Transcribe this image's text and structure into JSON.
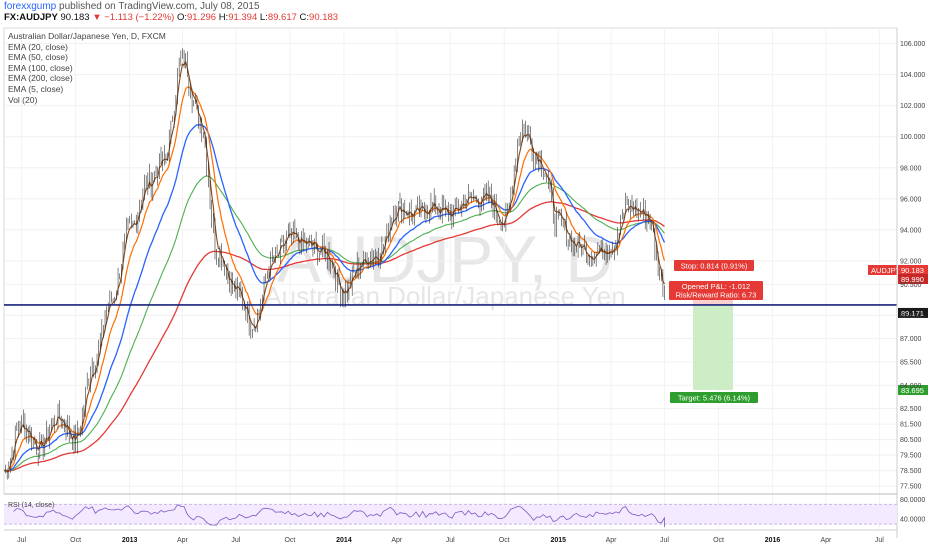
{
  "header": {
    "author": "forexxgump",
    "published_text": "published on TradingView.com, July 08, 2015",
    "symbol": "FX:AUDJPY",
    "last": "90.183",
    "change_arrow": "▼",
    "change": "−1.113 (−1.22%)",
    "open_label": "O:",
    "open": "91.296",
    "high_label": "H:",
    "high": "91.394",
    "low_label": "L:",
    "low": "89.617",
    "close_label": "C:",
    "close": "90.183"
  },
  "legend": {
    "title": "Australian Dollar/Japanese Yen, D, FXCM",
    "items": [
      "EMA (20, close)",
      "EMA (50, close)",
      "EMA (100, close)",
      "EMA (200, close)",
      "EMA (5, close)",
      "Vol (20)"
    ]
  },
  "watermark": {
    "symbol": "AUDJPY, D",
    "name": "Australian Dollar/Japanese Yen"
  },
  "annotations": {
    "stop": "Stop: 0.814 (0.91%)",
    "pnl": "Opened P&L: -1.012",
    "rr": "Risk/Reward Ratio: 6.73",
    "target": "Target: 5.476 (6.14%)"
  },
  "price_tags": {
    "symbol_tag": "AUDJPY",
    "last": "90.183",
    "hidden": "89.990",
    "entry": "89.171",
    "target": "83.695"
  },
  "rsi": {
    "label": "RSI (14, close)",
    "ticks": [
      "80.0000",
      "40.0000"
    ],
    "upper_band": 70,
    "lower_band": 30
  },
  "colors": {
    "ema20": "#ff6d00",
    "ema50": "#2962ff",
    "ema100": "#4caf50",
    "ema200": "#e53935",
    "ema5": "#8b4513",
    "price_line": "#1a237e",
    "rsi": "#7e57c2",
    "stop": "#e53935",
    "target": "#2e9e2e"
  },
  "chart_data": {
    "type": "candlestick",
    "y_ticks": [
      106,
      104,
      102,
      100,
      98,
      96,
      94,
      92,
      90.5,
      88.5,
      87,
      85.5,
      84,
      82.5,
      81.5,
      80.5,
      79.5,
      78.5,
      77.5
    ],
    "y_tick_labels": [
      "106.000",
      "104.000",
      "102.000",
      "100.000",
      "98.000",
      "96.000",
      "94.000",
      "92.000",
      "90.500",
      "88.500",
      "87.000",
      "85.500",
      "84.000",
      "82.500",
      "81.500",
      "80.500",
      "79.500",
      "78.500",
      "77.500"
    ],
    "x_ticks": [
      "Jul",
      "Oct",
      "2013",
      "Apr",
      "Jul",
      "Oct",
      "2014",
      "Apr",
      "Jul",
      "Oct",
      "2015",
      "Apr",
      "Jul",
      "Oct",
      "2016",
      "Apr",
      "Jul"
    ],
    "close_path": [
      {
        "date": "2012-06-01",
        "price": 78.5
      },
      {
        "date": "2012-07-01",
        "price": 81.5
      },
      {
        "date": "2012-08-01",
        "price": 80.0
      },
      {
        "date": "2012-09-01",
        "price": 82.0
      },
      {
        "date": "2012-10-01",
        "price": 80.5
      },
      {
        "date": "2012-11-01",
        "price": 85.5
      },
      {
        "date": "2012-12-01",
        "price": 89.5
      },
      {
        "date": "2013-01-01",
        "price": 94.0
      },
      {
        "date": "2013-02-01",
        "price": 97.0
      },
      {
        "date": "2013-03-01",
        "price": 98.5
      },
      {
        "date": "2013-04-01",
        "price": 105.0
      },
      {
        "date": "2013-05-01",
        "price": 101.0
      },
      {
        "date": "2013-06-01",
        "price": 92.5
      },
      {
        "date": "2013-07-01",
        "price": 90.0
      },
      {
        "date": "2013-08-01",
        "price": 88.0
      },
      {
        "date": "2013-09-01",
        "price": 92.0
      },
      {
        "date": "2013-10-01",
        "price": 93.5
      },
      {
        "date": "2013-11-01",
        "price": 93.0
      },
      {
        "date": "2013-12-01",
        "price": 92.5
      },
      {
        "date": "2014-01-01",
        "price": 90.0
      },
      {
        "date": "2014-02-01",
        "price": 92.0
      },
      {
        "date": "2014-03-01",
        "price": 92.5
      },
      {
        "date": "2014-04-01",
        "price": 95.5
      },
      {
        "date": "2014-05-01",
        "price": 95.0
      },
      {
        "date": "2014-06-01",
        "price": 95.5
      },
      {
        "date": "2014-07-01",
        "price": 95.0
      },
      {
        "date": "2014-08-01",
        "price": 96.0
      },
      {
        "date": "2014-09-01",
        "price": 96.0
      },
      {
        "date": "2014-10-01",
        "price": 94.5
      },
      {
        "date": "2014-11-01",
        "price": 100.5
      },
      {
        "date": "2014-12-01",
        "price": 98.5
      },
      {
        "date": "2015-01-01",
        "price": 94.5
      },
      {
        "date": "2015-02-01",
        "price": 93.0
      },
      {
        "date": "2015-03-01",
        "price": 92.5
      },
      {
        "date": "2015-04-01",
        "price": 93.0
      },
      {
        "date": "2015-05-01",
        "price": 95.5
      },
      {
        "date": "2015-06-01",
        "price": 95.0
      },
      {
        "date": "2015-07-01",
        "price": 90.183
      }
    ],
    "entry_price": 89.171,
    "stop_price": 89.985,
    "target_price": 83.695,
    "ylim": [
      77.0,
      107.0
    ]
  }
}
